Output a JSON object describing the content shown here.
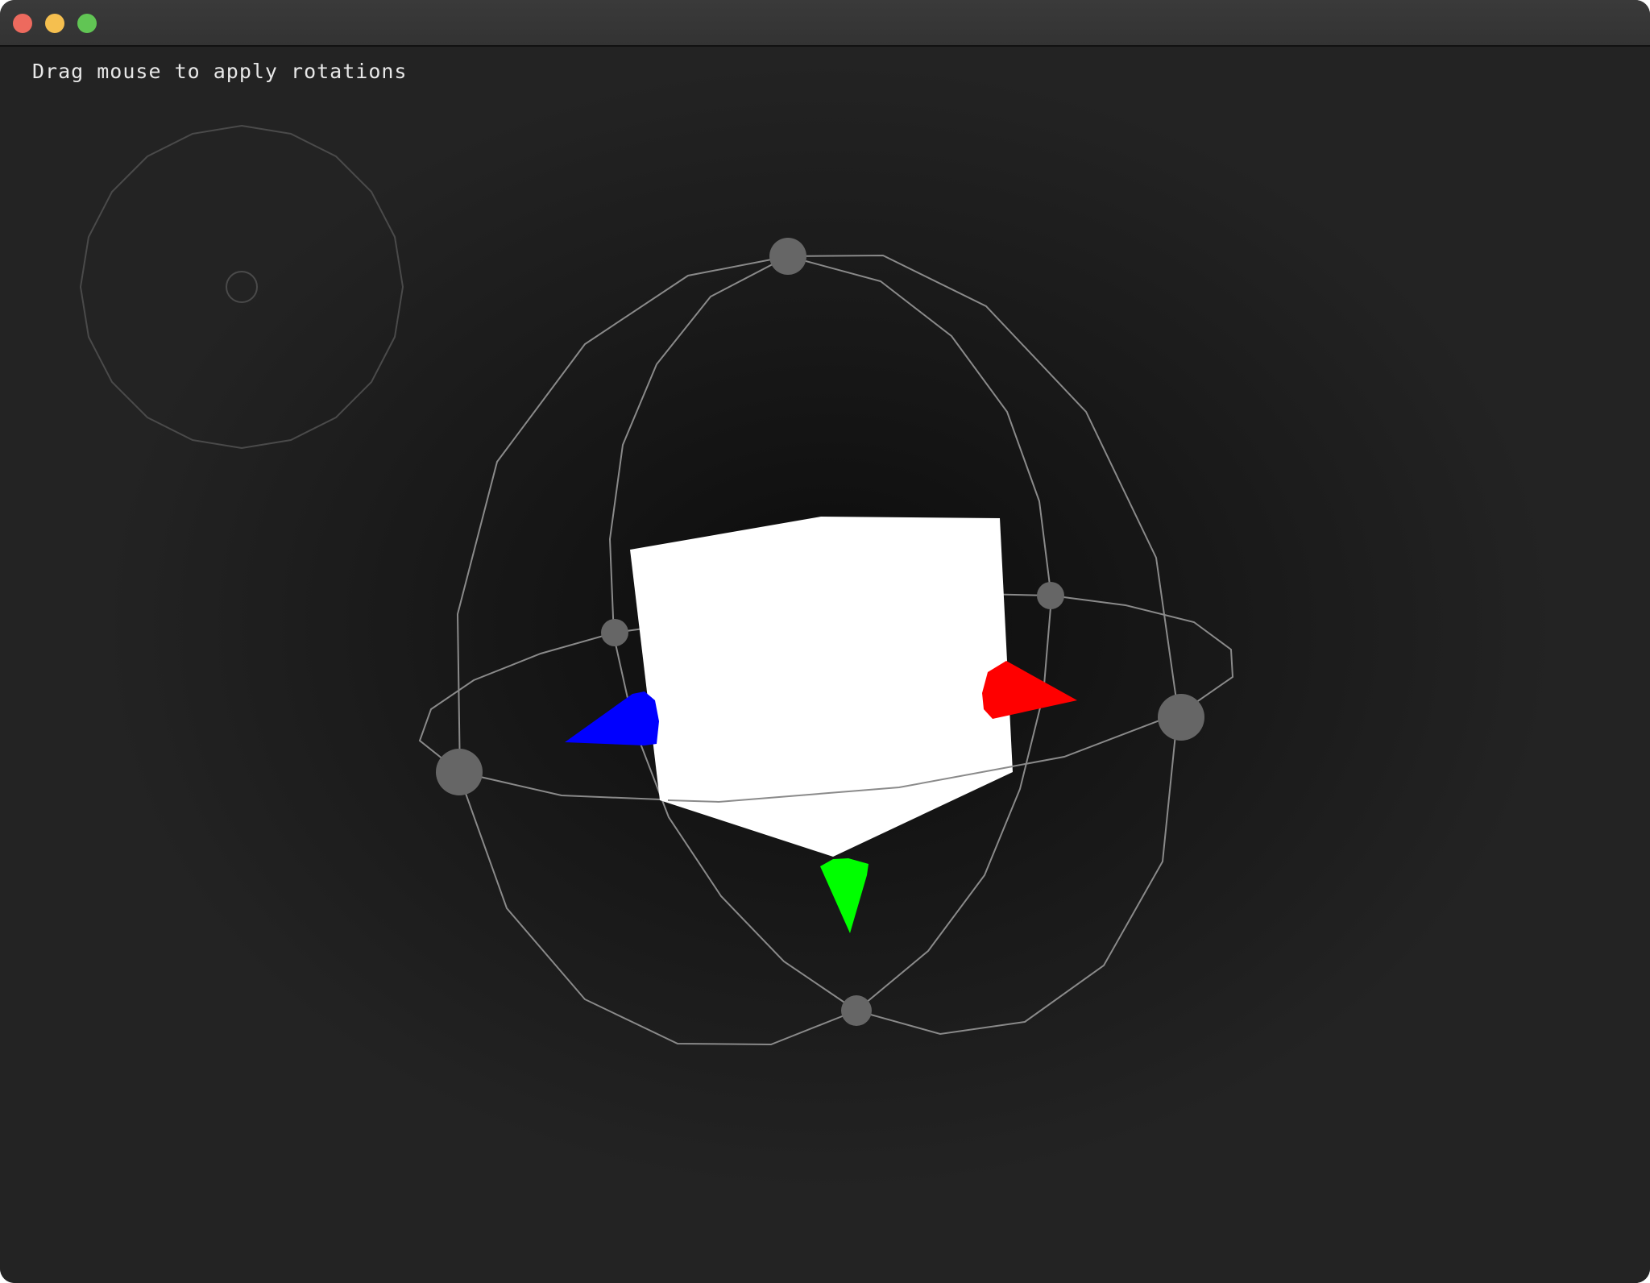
{
  "window": {
    "controls": [
      {
        "name": "close",
        "color": "#ed6a5e"
      },
      {
        "name": "minimize",
        "color": "#f5bf4f"
      },
      {
        "name": "zoom",
        "color": "#61c554"
      }
    ]
  },
  "viewport": {
    "hint_text": "Drag mouse to apply rotations",
    "background_color": "#141414",
    "cube_color": "#ffffff",
    "ring_color": "#8a8a8a",
    "handle_color": "#666666",
    "axis_colors": {
      "x": "#ff0000",
      "y": "#00ff00",
      "z": "#0000ff"
    },
    "icons": [
      "trackball-widget-icon",
      "rotation-gizmo-icon",
      "cube-icon"
    ]
  }
}
